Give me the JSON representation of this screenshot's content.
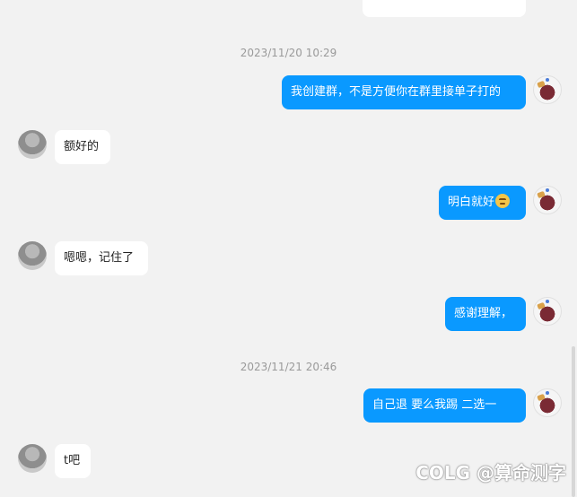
{
  "messages": {
    "time1": "2023/11/20 10:29",
    "msg1": "我创建群，不是方便你在群里接单子打的",
    "msg2": "额好的",
    "msg3": "明白就好",
    "msg4": "嗯嗯，记住了",
    "msg5": "感谢理解，",
    "time2": "2023/11/21 20:46",
    "msg6": "自己退  要么我踢   二选一",
    "msg7": "t吧"
  },
  "watermark": "COLG @算命测字",
  "colors": {
    "outgoing_bubble": "#0a99ff",
    "incoming_bubble": "#ffffff",
    "background": "#f2f2f2"
  }
}
